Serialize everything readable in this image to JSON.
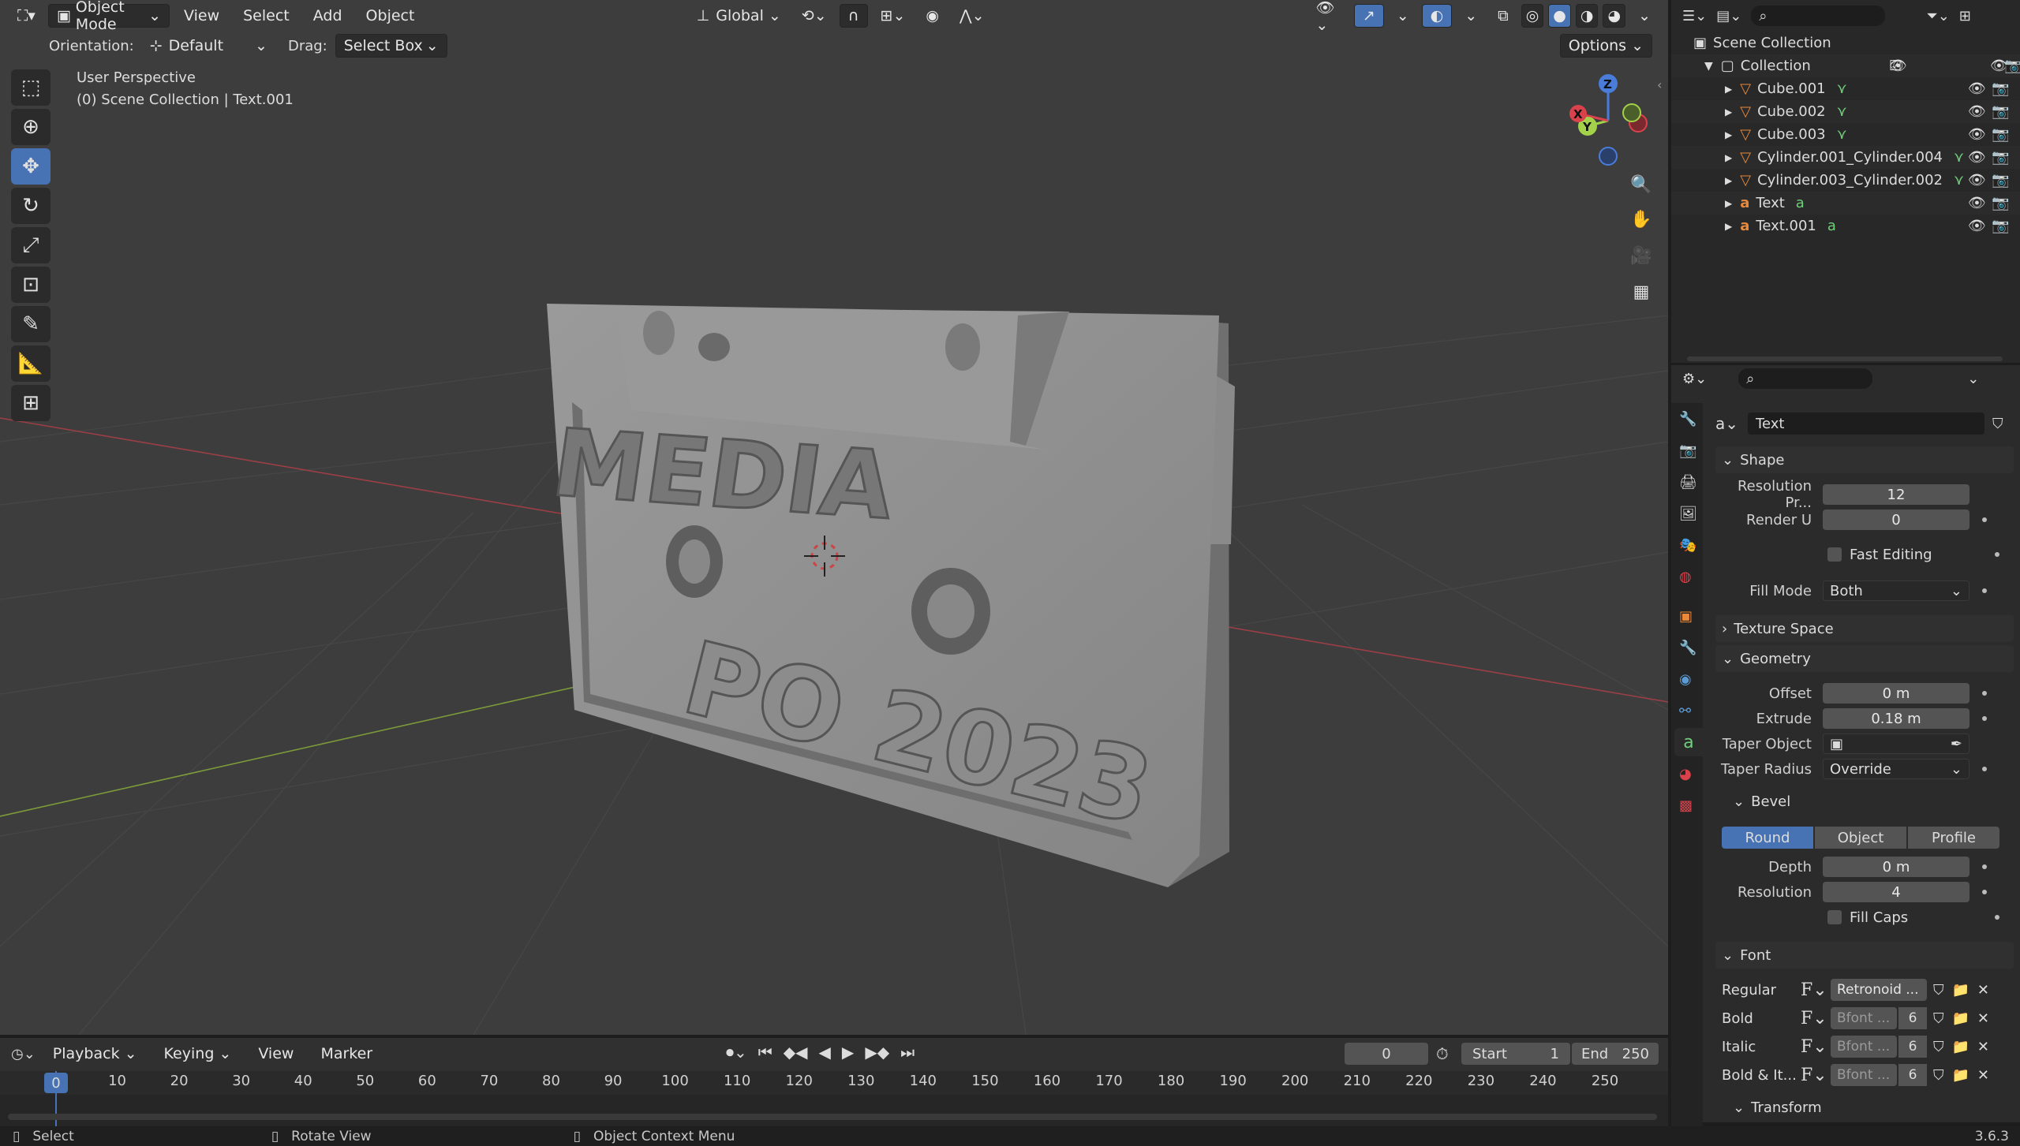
{
  "viewport": {
    "header": {
      "editor_icon": "view3d-icon",
      "mode": "Object Mode",
      "menus": [
        "View",
        "Select",
        "Add",
        "Object"
      ],
      "transform_orientation": "Global",
      "options_label": "Options"
    },
    "tool_settings": {
      "orientation_label": "Orientation:",
      "orientation_value": "Default",
      "drag_label": "Drag:",
      "drag_value": "Select Box"
    },
    "overlay_text": {
      "perspective": "User Perspective",
      "collection": "(0) Scene Collection | Text.001"
    },
    "gizmo_axes": {
      "z": "Z",
      "y": "Y",
      "x": "X"
    }
  },
  "outliner": {
    "scene_collection": "Scene Collection",
    "collection": "Collection",
    "items": [
      {
        "name": "Cube.001",
        "type": "mesh"
      },
      {
        "name": "Cube.002",
        "type": "mesh"
      },
      {
        "name": "Cube.003",
        "type": "mesh"
      },
      {
        "name": "Cylinder.001_Cylinder.004",
        "type": "mesh"
      },
      {
        "name": "Cylinder.003_Cylinder.002",
        "type": "mesh"
      },
      {
        "name": "Text",
        "type": "text"
      },
      {
        "name": "Text.001",
        "type": "text"
      }
    ]
  },
  "properties": {
    "datablock_name": "Text",
    "shape": {
      "title": "Shape",
      "resolution_preview_label": "Resolution Pr...",
      "resolution_preview": "12",
      "render_u_label": "Render U",
      "render_u": "0",
      "fast_editing_label": "Fast Editing",
      "fill_mode_label": "Fill Mode",
      "fill_mode": "Both"
    },
    "texture_space": {
      "title": "Texture Space"
    },
    "geometry": {
      "title": "Geometry",
      "offset_label": "Offset",
      "offset": "0 m",
      "extrude_label": "Extrude",
      "extrude": "0.18 m",
      "taper_object_label": "Taper Object",
      "taper_radius_label": "Taper Radius",
      "taper_radius": "Override"
    },
    "bevel": {
      "title": "Bevel",
      "modes": [
        "Round",
        "Object",
        "Profile"
      ],
      "depth_label": "Depth",
      "depth": "0 m",
      "resolution_label": "Resolution",
      "resolution": "4",
      "fill_caps_label": "Fill Caps"
    },
    "font": {
      "title": "Font",
      "rows": [
        {
          "label": "Regular",
          "value": "Retronoid ...",
          "users": ""
        },
        {
          "label": "Bold",
          "value": "Bfont ...",
          "users": "6"
        },
        {
          "label": "Italic",
          "value": "Bfont ...",
          "users": "6"
        },
        {
          "label": "Bold & It...",
          "value": "Bfont ...",
          "users": "6"
        }
      ]
    },
    "transform": {
      "title": "Transform"
    }
  },
  "timeline": {
    "menus": [
      "Playback",
      "Keying",
      "View",
      "Marker"
    ],
    "current_frame": "0",
    "start_label": "Start",
    "start": "1",
    "end_label": "End",
    "end": "250",
    "playhead": "0",
    "ticks": [
      "10",
      "20",
      "30",
      "40",
      "50",
      "60",
      "70",
      "80",
      "90",
      "100",
      "110",
      "120",
      "130",
      "140",
      "150",
      "160",
      "170",
      "180",
      "190",
      "200",
      "210",
      "220",
      "230",
      "240",
      "250"
    ]
  },
  "statusbar": {
    "select": "Select",
    "rotate": "Rotate View",
    "context": "Object Context Menu",
    "version": "3.6.3"
  },
  "model_text": {
    "line1": "MEDIA",
    "line2": "PO 2023"
  },
  "colors": {
    "accent": "#4772b3",
    "mesh": "#e8893b",
    "text_data": "#6fd07a"
  }
}
